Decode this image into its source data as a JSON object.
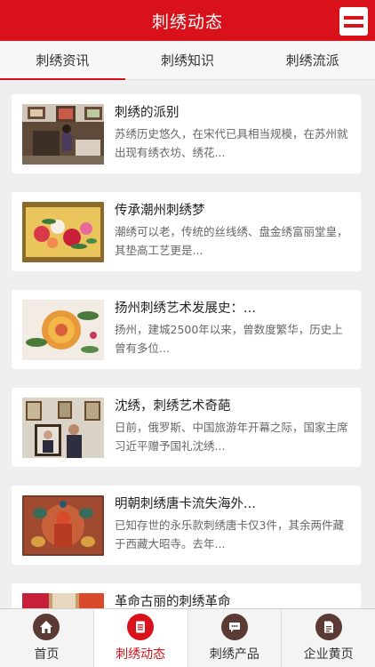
{
  "header": {
    "title": "刺绣动态"
  },
  "tabs": [
    {
      "label": "刺绣资讯"
    },
    {
      "label": "刺绣知识"
    },
    {
      "label": "刺绣流派"
    }
  ],
  "articles": [
    {
      "title": "刺绣的派别",
      "desc": "苏绣历史悠久，在宋代已具相当规模，在苏州就出现有绣衣坊、绣花..."
    },
    {
      "title": "传承潮州刺绣梦",
      "desc": "潮绣可以老，传统的丝线绣、盘金绣富丽堂皇，其垫高工艺更是..."
    },
    {
      "title": "扬州刺绣艺术发展史：...",
      "desc": "扬州，建城2500年以来，曾数度繁华，历史上曾有多位..."
    },
    {
      "title": "沈绣，刺绣艺术奇葩",
      "desc": "日前，俄罗斯、中国旅游年开幕之际，国家主席习近平赠予国礼沈绣..."
    },
    {
      "title": "明朝刺绣唐卡流失海外...",
      "desc": "已知存世的永乐款刺绣唐卡仅3件，其余两件藏于西藏大昭寺。去年..."
    },
    {
      "title": "革命古丽的刺绣革命",
      "desc": ""
    }
  ],
  "bottom_nav": [
    {
      "label": "首页",
      "icon": "home-icon"
    },
    {
      "label": "刺绣动态",
      "icon": "document-icon"
    },
    {
      "label": "刺绣产品",
      "icon": "chat-icon"
    },
    {
      "label": "企业黄页",
      "icon": "file-icon"
    }
  ],
  "colors": {
    "primary": "#d8111b",
    "icon_bg": "#5b3a33",
    "background": "#efefef"
  }
}
